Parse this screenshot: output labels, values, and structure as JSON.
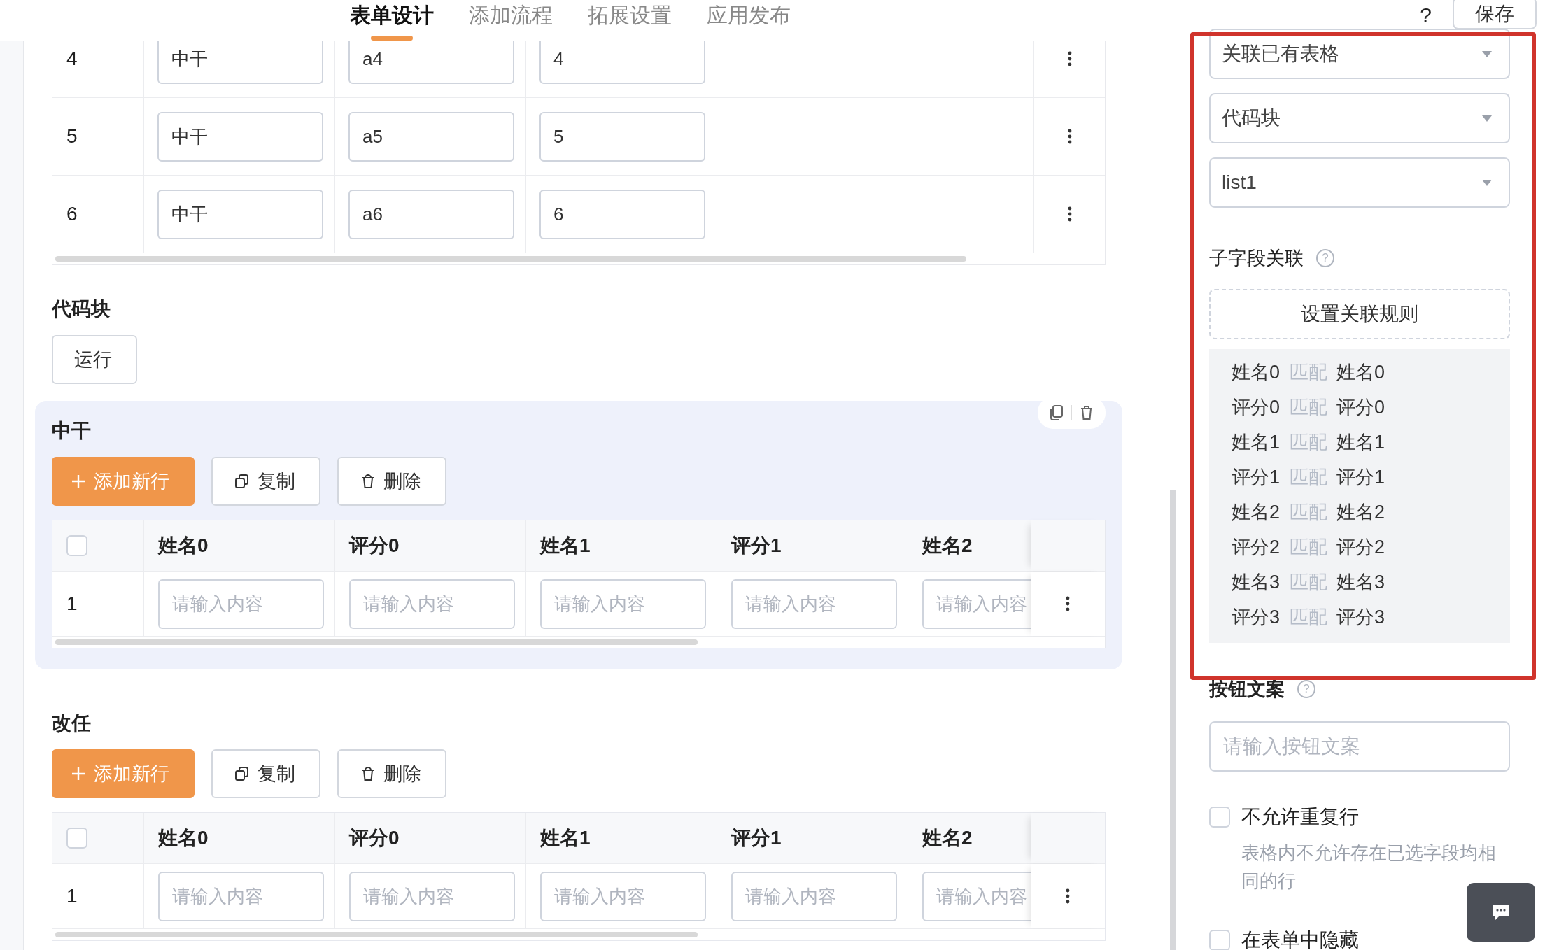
{
  "header": {
    "tabs": [
      {
        "label": "表单设计",
        "selected": true
      },
      {
        "label": "添加流程",
        "selected": false
      },
      {
        "label": "拓展设置",
        "selected": false
      },
      {
        "label": "应用发布",
        "selected": false
      }
    ],
    "help": "?",
    "save": "保存"
  },
  "top_table": {
    "rows": [
      {
        "index": "4",
        "cells": [
          "中干",
          "a4",
          "4"
        ]
      },
      {
        "index": "5",
        "cells": [
          "中干",
          "a5",
          "5"
        ]
      },
      {
        "index": "6",
        "cells": [
          "中干",
          "a6",
          "6"
        ]
      }
    ]
  },
  "code_block": {
    "title": "代码块",
    "button": "运行"
  },
  "subtables": [
    {
      "title": "中干",
      "selected": true,
      "actions": [
        "添加新行",
        "复制",
        "删除"
      ],
      "checked": false,
      "columns": [
        "姓名0",
        "评分0",
        "姓名1",
        "评分1",
        "姓名2"
      ],
      "rows": [
        {
          "index": "1",
          "placeholders": [
            "请输入内容",
            "请输入内容",
            "请输入内容",
            "请输入内容",
            "请输入内容"
          ]
        }
      ]
    },
    {
      "title": "改任",
      "selected": false,
      "actions": [
        "添加新行",
        "复制",
        "删除"
      ],
      "checked": false,
      "columns": [
        "姓名0",
        "评分0",
        "姓名1",
        "评分1",
        "姓名2"
      ],
      "rows": [
        {
          "index": "1",
          "placeholders": [
            "请输入内容",
            "请输入内容",
            "请输入内容",
            "请输入内容",
            "请输入内容"
          ]
        }
      ]
    }
  ],
  "right_panel": {
    "highlighted": true,
    "selects": [
      "关联已有表格",
      "代码块",
      "list1"
    ],
    "subfield_label": "子字段关联",
    "subfield_hint": "?",
    "rule_button": "设置关联规则",
    "mappings": [
      {
        "source": "姓名0",
        "relation": "匹配",
        "target": "姓名0"
      },
      {
        "source": "评分0",
        "relation": "匹配",
        "target": "评分0"
      },
      {
        "source": "姓名1",
        "relation": "匹配",
        "target": "姓名1"
      },
      {
        "source": "评分1",
        "relation": "匹配",
        "target": "评分1"
      },
      {
        "source": "姓名2",
        "relation": "匹配",
        "target": "姓名2"
      },
      {
        "source": "评分2",
        "relation": "匹配",
        "target": "评分2"
      },
      {
        "source": "姓名3",
        "relation": "匹配",
        "target": "姓名3"
      },
      {
        "source": "评分3",
        "relation": "匹配",
        "target": "评分3"
      }
    ],
    "button_text": {
      "label": "按钮文案",
      "hint": "?",
      "placeholder": "请输入按钮文案"
    },
    "options": [
      {
        "label": "不允许重复行",
        "checked": false,
        "help": "表格内不允许存在已选字段均相同的行"
      },
      {
        "label": "在表单中隐藏",
        "checked": false
      }
    ]
  }
}
